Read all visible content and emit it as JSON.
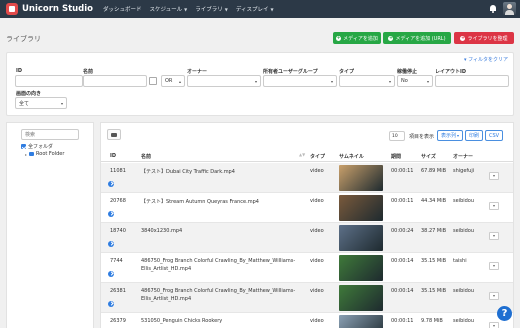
{
  "app": {
    "name": "Unicorn Studio"
  },
  "nav": {
    "items": [
      {
        "label": "ダッシュボード",
        "dropdown": false
      },
      {
        "label": "スケジュール",
        "dropdown": true
      },
      {
        "label": "ライブラリ",
        "dropdown": true
      },
      {
        "label": "ディスプレイ",
        "dropdown": true
      }
    ]
  },
  "page": {
    "title": "ライブラリ"
  },
  "actions": {
    "add_media": "メディアを追加",
    "add_media_url": "メディアを追加 (URL)",
    "organize_library": "ライブラリを整理"
  },
  "filters": {
    "clear_label": "フィルタをクリア",
    "id_label": "ID",
    "name_label": "名前",
    "or_label": "OR",
    "owner_label": "オーナー",
    "owner_group_label": "所有者ユーザーグループ",
    "type_label": "タイプ",
    "retired_label": "稼働停止",
    "retired_value": "No",
    "layout_id_label": "レイアウトID",
    "orientation_label": "画面の向き",
    "orientation_value": "全て"
  },
  "folders": {
    "search_placeholder": "検索",
    "all_folders": "全フォルダ",
    "root_folder": "Root Folder"
  },
  "table": {
    "per_page_value": "10",
    "per_page_label": "項目を表示",
    "column_visibility": "表示列",
    "print": "印刷",
    "csv": "CSV",
    "columns": [
      "ID",
      "名前",
      "タイプ",
      "サムネイル",
      "期間",
      "サイズ",
      "オーナー"
    ],
    "rows": [
      {
        "id": "11081",
        "name": "【テスト】Dubai City Traffic Dark.mp4",
        "name2": "",
        "type": "video",
        "duration": "00:00:11",
        "size": "67.89 MiB",
        "owner": "shigefuji",
        "thumb_color": "#c9a06b"
      },
      {
        "id": "20768",
        "name": "【テスト】Stream Autumn Queyras France.mp4",
        "name2": "",
        "type": "video",
        "duration": "00:00:11",
        "size": "44.34 MiB",
        "owner": "seibidou",
        "thumb_color": "#7a5a3c"
      },
      {
        "id": "18740",
        "name": "3840x1230.mp4",
        "name2": "",
        "type": "video",
        "duration": "00:00:24",
        "size": "38.27 MiB",
        "owner": "seibidou",
        "thumb_color": "#5d7088"
      },
      {
        "id": "7744",
        "name": "486750_Frog Branch Colorful Crawling_By_Matthew_Williams-",
        "name2": "Ellis_Artlist_HD.mp4",
        "type": "video",
        "duration": "00:00:14",
        "size": "35.15 MiB",
        "owner": "taishi",
        "thumb_color": "#3f7a3a"
      },
      {
        "id": "26381",
        "name": "486750_Frog Branch Colorful Crawling_By_Matthew_Williams-",
        "name2": "Ellis_Artlist_HD.mp4",
        "type": "video",
        "duration": "00:00:14",
        "size": "35.15 MiB",
        "owner": "seibidou",
        "thumb_color": "#3f7a3a"
      },
      {
        "id": "26379",
        "name": "531050_Penguin Chicks Rookery",
        "name2": "",
        "type": "video",
        "duration": "00:00:11",
        "size": "9.78 MiB",
        "owner": "seibidou",
        "thumb_color": "#8aa0b4"
      }
    ]
  }
}
